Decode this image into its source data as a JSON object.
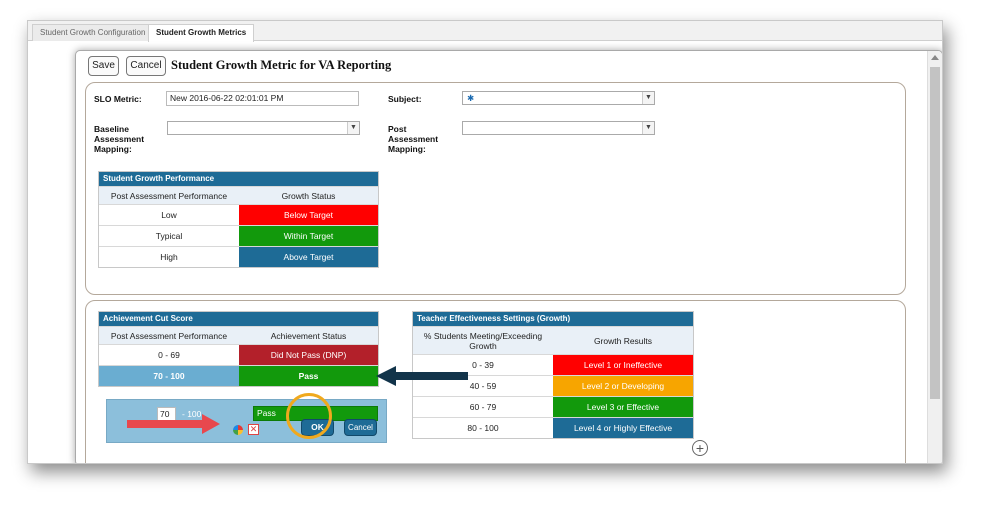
{
  "tabs": [
    {
      "label": "Student Growth Configuration",
      "active": false
    },
    {
      "label": "Student Growth Metrics",
      "active": true
    }
  ],
  "toolbar": {
    "save_label": "Save",
    "cancel_label": "Cancel"
  },
  "dialog": {
    "title": "Student Growth Metric for VA Reporting"
  },
  "form": {
    "slo_metric_label": "SLO Metric:",
    "slo_metric_value": "New 2016-06-22 02:01:01 PM",
    "subject_label": "Subject:",
    "subject_value": "✱",
    "baseline_label": "Baseline Assessment Mapping:",
    "baseline_value": "",
    "post_label": "Post Assessment Mapping:",
    "post_value": ""
  },
  "growth_performance": {
    "title": "Student Growth Performance",
    "headers": [
      "Post Assessment Performance",
      "Growth Status"
    ],
    "rows": [
      {
        "performance": "Low",
        "status": "Below Target",
        "color": "#ff0000"
      },
      {
        "performance": "Typical",
        "status": "Within Target",
        "color": "#12990c"
      },
      {
        "performance": "High",
        "status": "Above Target",
        "color": "#1e6b96"
      }
    ]
  },
  "achievement_cut": {
    "title": "Achievement Cut Score",
    "headers": [
      "Post Assessment Performance",
      "Achievement Status"
    ],
    "rows": [
      {
        "range": "0 - 69",
        "status": "Did Not Pass (DNP)",
        "color": "#b3202a"
      },
      {
        "range": "70 - 100",
        "status": "Pass",
        "color": "#12990c"
      }
    ],
    "editor": {
      "min_value": "70",
      "range_suffix": "- 100",
      "status_value": "Pass",
      "ok_label": "OK",
      "cancel_label": "Cancel"
    }
  },
  "teacher_effectiveness": {
    "title": "Teacher Effectiveness Settings (Growth)",
    "headers": [
      "% Students Meeting/Exceeding Growth",
      "Growth Results"
    ],
    "rows": [
      {
        "range": "0 - 39",
        "result": "Level 1 or Ineffective",
        "color": "#ff0000"
      },
      {
        "range": "40 - 59",
        "result": "Level 2 or Developing",
        "color": "#f7a500"
      },
      {
        "range": "60 - 79",
        "result": "Level 3 or Effective",
        "color": "#12990c"
      },
      {
        "range": "80 - 100",
        "result": "Level 4 or Highly Effective",
        "color": "#1e6b96"
      }
    ]
  }
}
